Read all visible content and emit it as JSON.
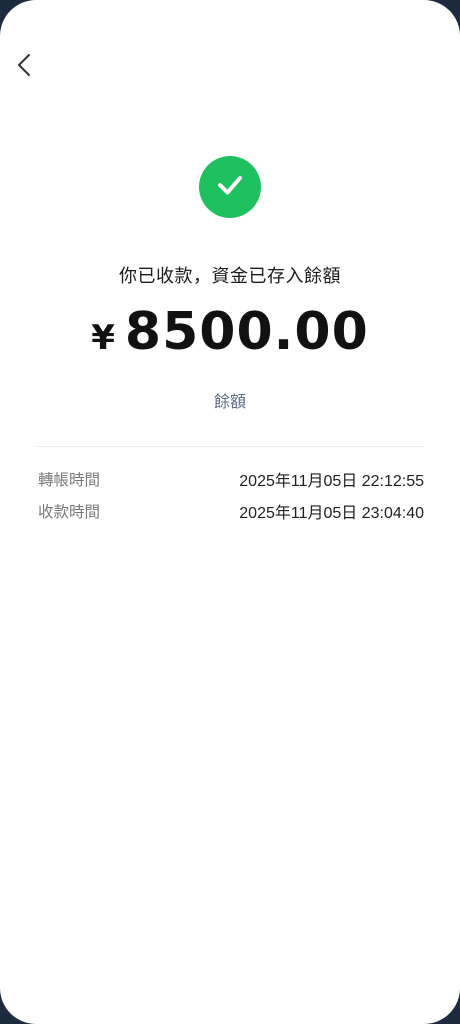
{
  "header": {
    "back_icon": "chevron-left-icon"
  },
  "status": {
    "icon": "check-icon",
    "accent_color": "#1fc05f",
    "message": "你已收款，資金已存入餘額"
  },
  "amount": {
    "currency_symbol": "¥",
    "value": "8500.00"
  },
  "balance_link": {
    "label": "餘額"
  },
  "details": [
    {
      "label": "轉帳時間",
      "value": "2025年11月05日 22:12:55"
    },
    {
      "label": "收款時間",
      "value": "2025年11月05日 23:04:40"
    }
  ]
}
